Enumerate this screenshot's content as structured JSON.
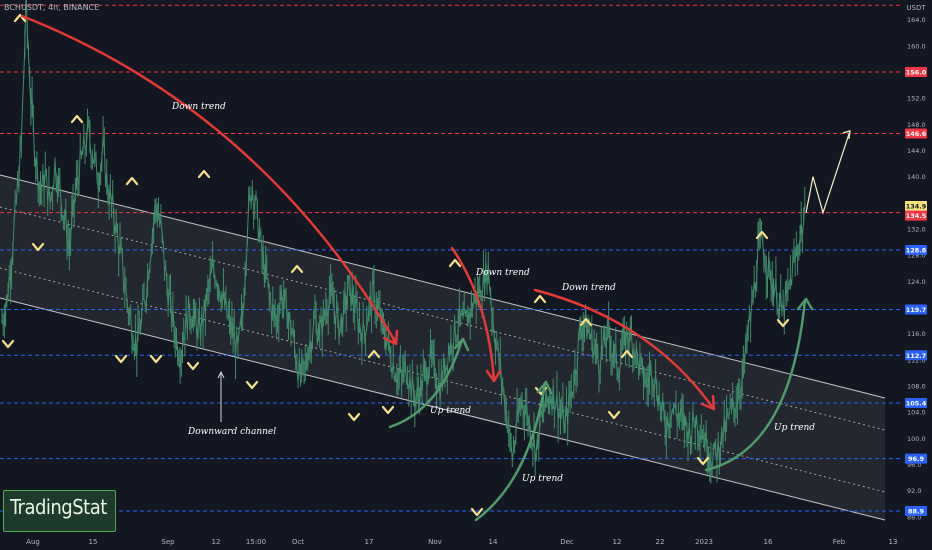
{
  "symbol": "BCHUSDT, 4h, BINANCE",
  "currency": "USDT",
  "brand": "TradingStat",
  "colors": {
    "background": "#131722",
    "candles": "#3e8c6a",
    "red_level": "#f23645",
    "blue_level": "#2962ff",
    "channel": "#c8c8c8",
    "arrow_red": "#e53935",
    "arrow_green": "#4e9a6b",
    "marker": "#f5e08a"
  },
  "chart_data": {
    "type": "line",
    "ylim": [
      86,
      167
    ],
    "y_ticks": [
      88.0,
      92.0,
      96.0,
      100.0,
      104.0,
      108.0,
      112.0,
      116.0,
      120.0,
      124.0,
      128.0,
      132.0,
      136.0,
      140.0,
      144.0,
      148.0,
      152.0,
      156.0,
      160.0,
      164.0
    ],
    "x_ticks": [
      "Aug",
      "15",
      "Sep",
      "12",
      "15:00",
      "Oct",
      "17",
      "Nov",
      "14",
      "Dec",
      "12",
      "22",
      "2023",
      "16",
      "Feb",
      "13"
    ],
    "levels": [
      {
        "value": 166.2,
        "style": "red",
        "label": ""
      },
      {
        "value": 156.0,
        "style": "red",
        "label": "156.0"
      },
      {
        "value": 146.6,
        "style": "red",
        "label": "146.6"
      },
      {
        "value": 134.9,
        "style": "price",
        "label": "134.9"
      },
      {
        "value": 134.5,
        "style": "red",
        "label": "134.5"
      },
      {
        "value": 128.8,
        "style": "blue",
        "label": "128.8"
      },
      {
        "value": 119.7,
        "style": "blue",
        "label": "119.7"
      },
      {
        "value": 112.7,
        "style": "blue",
        "label": "112.7"
      },
      {
        "value": 105.4,
        "style": "blue",
        "label": "105.4"
      },
      {
        "value": 96.9,
        "style": "blue",
        "label": "96.9"
      },
      {
        "value": 88.9,
        "style": "blue",
        "label": "88.9"
      }
    ],
    "price_series": [
      118,
      121,
      128,
      136,
      145,
      166,
      152,
      143,
      138,
      140,
      136,
      142,
      138,
      134,
      129,
      136,
      141,
      144,
      147,
      143,
      140,
      144,
      138,
      135,
      131,
      126,
      121,
      117,
      114,
      118,
      123,
      130,
      136,
      132,
      125,
      120,
      116,
      113,
      117,
      120,
      118,
      116,
      119,
      123,
      126,
      124,
      121,
      118,
      116,
      113,
      119,
      133,
      139,
      134,
      128,
      124,
      120,
      118,
      122,
      120,
      117,
      113,
      109,
      111,
      115,
      118,
      116,
      119,
      122,
      120,
      117,
      119,
      123,
      121,
      118,
      116,
      119,
      122,
      120,
      117,
      115,
      112,
      110,
      109,
      111,
      108,
      106,
      108,
      110,
      112,
      110,
      108,
      111,
      114,
      116,
      118,
      117,
      119,
      121,
      122,
      124,
      126,
      118,
      113,
      108,
      103,
      97,
      102,
      106,
      104,
      101,
      98,
      103,
      105,
      107,
      106,
      104,
      102,
      106,
      110,
      116,
      118,
      116,
      114,
      112,
      114,
      116,
      113,
      111,
      114,
      116,
      115,
      112,
      110,
      108,
      111,
      108,
      104,
      102,
      105,
      104,
      103,
      102,
      101,
      103,
      102,
      100,
      98,
      97,
      99,
      101,
      103,
      105,
      107,
      110,
      116,
      121,
      128,
      130,
      126,
      124,
      122,
      119,
      121,
      125,
      128,
      132,
      134
    ],
    "projection": [
      134.5,
      140,
      134.5,
      147
    ],
    "annotations": [
      {
        "text": "Down trend"
      },
      {
        "text": "Down trend"
      },
      {
        "text": "Down trend"
      },
      {
        "text": "Up trend"
      },
      {
        "text": "Up trend"
      },
      {
        "text": "Up trend"
      },
      {
        "text": "Downward channel"
      }
    ]
  }
}
